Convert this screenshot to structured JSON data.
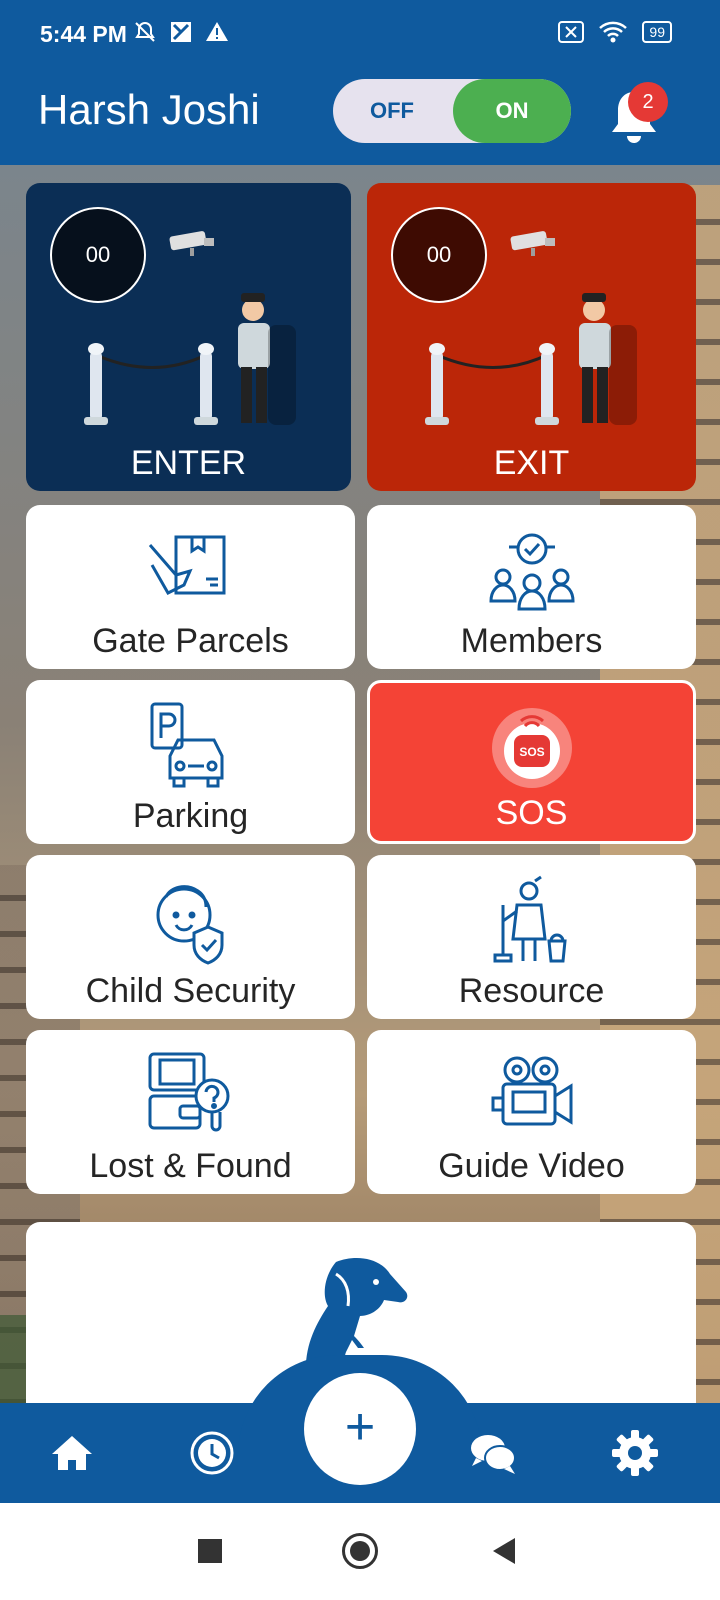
{
  "status_bar": {
    "time": "5:44 PM",
    "battery": "99"
  },
  "header": {
    "user_name": "Harsh Joshi",
    "toggle_off": "OFF",
    "toggle_on": "ON",
    "notification_count": "2"
  },
  "gates": {
    "enter": {
      "count": "00",
      "label": "ENTER"
    },
    "exit": {
      "count": "00",
      "label": "EXIT"
    }
  },
  "tiles": {
    "gate_parcels": "Gate Parcels",
    "members": "Members",
    "parking": "Parking",
    "sos": "SOS",
    "sos_icon_text": "SOS",
    "child_security": "Child Security",
    "resource": "Resource",
    "lost_found": "Lost & Found",
    "guide_video": "Guide Video"
  },
  "fab": {
    "label": "+"
  },
  "colors": {
    "primary": "#0f5a9e",
    "enter_bg": "#0b2e55",
    "exit_bg": "#bb2608",
    "sos_bg": "#f44336",
    "toggle_on": "#4caf50"
  }
}
